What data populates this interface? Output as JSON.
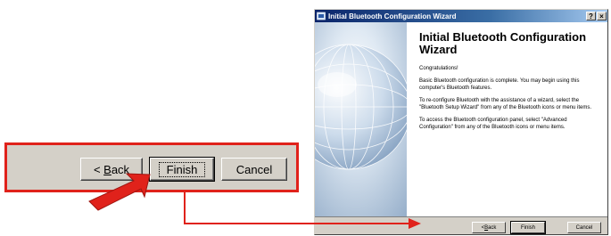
{
  "zoom": {
    "back_label_rest": "ack",
    "back_label_mnemonic": "B",
    "finish_label": "Finish",
    "cancel_label": "Cancel"
  },
  "dialog": {
    "title": "Initial Bluetooth Configuration Wizard",
    "help_button": "?",
    "close_button": "×",
    "heading": "Initial Bluetooth Configuration Wizard",
    "paragraphs": [
      "Congratulations!",
      "Basic Bluetooth configuration is complete.  You may begin using this computer's Bluetooth features.",
      "To re-configure Bluetooth with the assistance of a wizard, select the \"Bluetooth Setup Wizard\" from any of the Bluetooth icons or menu items.",
      "To access the Bluetooth configuration panel, select \"Advanced Configuration\" from any of the Bluetooth icons or menu items."
    ],
    "buttons": {
      "back_mnemonic": "B",
      "back_rest": "ack",
      "back_prefix": "< ",
      "finish": "Finish",
      "cancel": "Cancel"
    }
  },
  "colors": {
    "callout_red": "#e0221b",
    "dialog_face": "#d4d0c8",
    "titlebar_start": "#0a246a"
  },
  "icons": {
    "title_icon": "bluetooth-wizard-icon",
    "arrow": "red-pointer-arrow"
  }
}
